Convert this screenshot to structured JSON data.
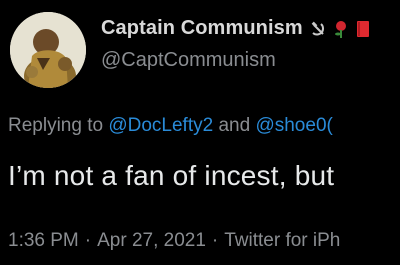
{
  "profile": {
    "display_name": "Captain Communism",
    "handle": "@CaptCommunism",
    "name_emojis": [
      "hammer-sickle-icon",
      "rose-icon",
      "red-book-icon"
    ],
    "accent_color": "#2a8bd8"
  },
  "reply": {
    "prefix": "Replying to",
    "mention_1": "@DocLefty2",
    "conjunction": "and",
    "mention_2": "@shoe0("
  },
  "tweet": {
    "text": "I’m not a fan of incest, but"
  },
  "meta": {
    "time": "1:36 PM",
    "separator_1": "·",
    "date": "Apr 27, 2021",
    "separator_2": "·",
    "source": "Twitter for iPh"
  }
}
